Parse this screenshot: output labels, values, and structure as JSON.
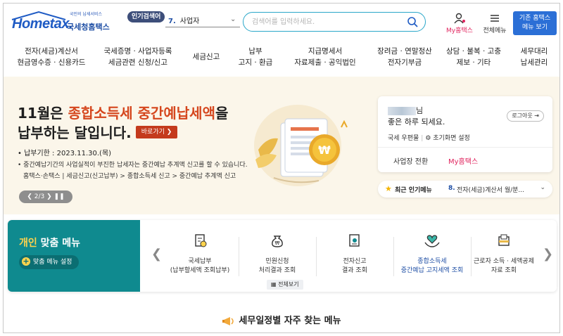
{
  "header": {
    "logo_small": "국민의 납세서비스",
    "logo_main": "Hometax.",
    "logo_sub": "국세청홈택스",
    "popular_badge": "인기검색어",
    "popular_num": "7.",
    "popular_text": "사업자",
    "search_placeholder": "검색어를 입력하세요.",
    "my_label": "My홈택스",
    "allmenu_label": "전체메뉴",
    "legacy_line1": "기존 홈택스",
    "legacy_line2": "메뉴 보기"
  },
  "nav": [
    "전자(세금)계산서\n현금영수증 · 신용카드",
    "국세증명 · 사업자등록\n세금관련 신청/신고",
    "세금신고",
    "납부\n고지 · 환급",
    "지급명세서\n자료제출 · 공익법인",
    "장려금 · 연말정산\n전자기부금",
    "상담 · 불복 · 고충\n제보 · 기타",
    "세무대리\n납세관리"
  ],
  "hero": {
    "title_pre": "11월은 ",
    "title_hl": "종합소득세 중간예납세액",
    "title_post": "을",
    "title_line2": "납부하는 달입니다.",
    "go_label": "바로가기 ❯",
    "deadline": "• 납부기한 : 2023.11.30.(목)",
    "desc": "• 중간예납기간의 사업실적이 부진한 납세자는 중간예납 추계액 신고를 할 수 있습니다.",
    "path": "홈택스·손택스 | 세금신고(신고납부) > 종합소득세 신고 > 중간예납 추계액 신고",
    "pager": "❮  2/3  ❯  ❚❚"
  },
  "user": {
    "name_suffix": "님",
    "greet": "좋은 하루 되세요.",
    "logout": "로그아웃 ⇥",
    "mailbox": "국세 우편물",
    "init_setting": "초기화면 설정",
    "biz_switch": "사업장 전환",
    "my_hometax": "My홈택스"
  },
  "popular": {
    "label": "최근 인기메뉴",
    "num": "8.",
    "text": "전자(세금)계산서 월/분..."
  },
  "pmenu": {
    "title_a": "개인",
    "title_b": " 맞춤 메뉴",
    "setting": "맞춤 메뉴 설정",
    "items": [
      "국세납부\n(납부할세액 조회납부)",
      "민원신청\n처리결과 조회",
      "전자신고\n결과 조회",
      "종합소득세\n중간예납 고지세액 조회",
      "근로자 소득 · 세액공제\n자료 조회"
    ],
    "all_view": "전체보기"
  },
  "bottom_title": "세무일정별 자주 찾는 메뉴",
  "colors": {
    "brand": "#1f5bc4",
    "accent_red": "#d5461d",
    "teal": "#0f8a8f",
    "pink": "#e0245e"
  }
}
